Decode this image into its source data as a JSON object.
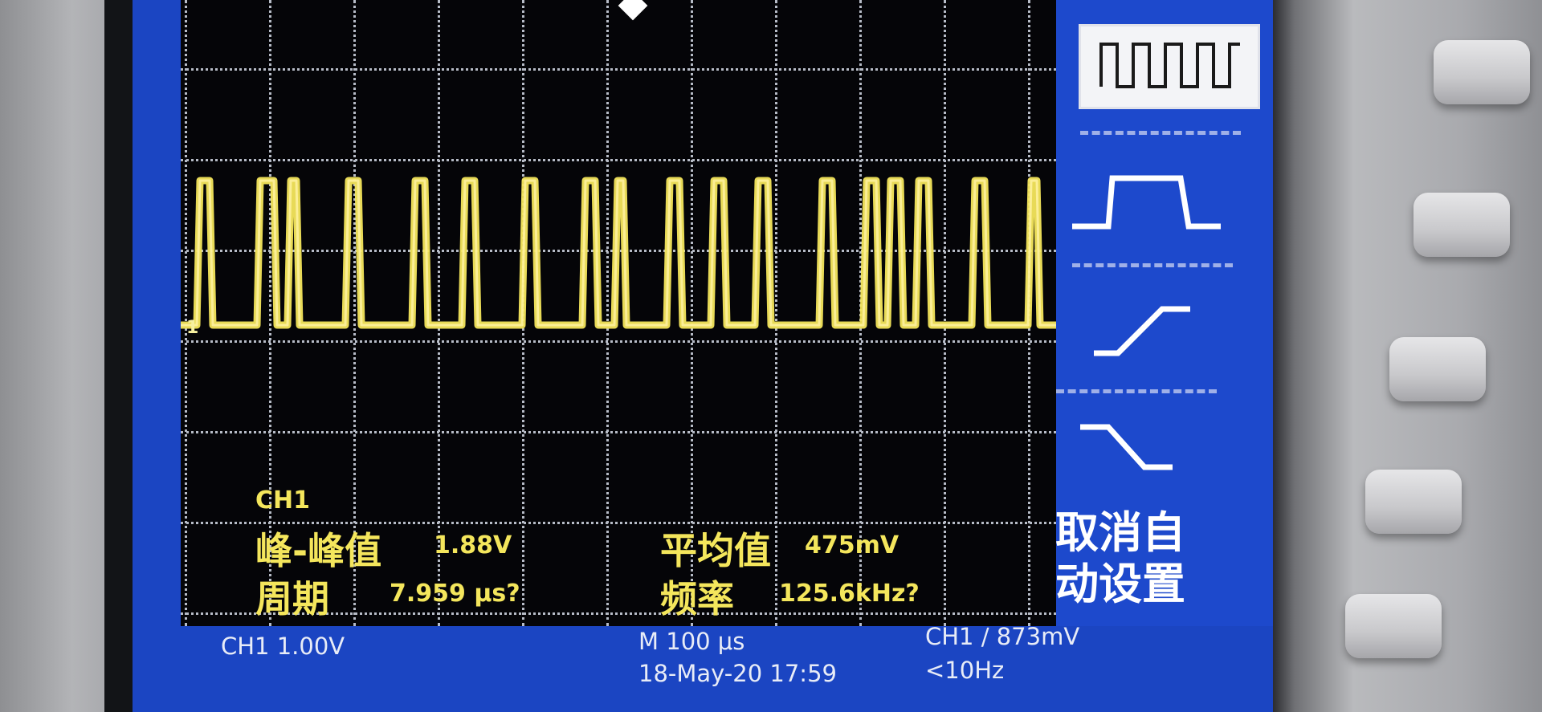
{
  "channel_marker": "1",
  "measurements": {
    "channel": "CH1",
    "peak_to_peak_label": "峰-峰值",
    "peak_to_peak_value": "1.88V",
    "period_label": "周期",
    "period_value": "7.959 μs?",
    "mean_label": "平均值",
    "mean_value": "475mV",
    "frequency_label": "频率",
    "frequency_value": "125.6kHz?"
  },
  "side_menu": {
    "items": [
      {
        "icon": "pulse-train-icon",
        "selected": true
      },
      {
        "icon": "pulse-icon",
        "selected": false
      },
      {
        "icon": "rising-edge-icon",
        "selected": false
      },
      {
        "icon": "falling-edge-icon",
        "selected": false
      }
    ],
    "cancel_label_line1": "取消自",
    "cancel_label_line2": "动设置"
  },
  "status_bar": {
    "channel_scale": "CH1  1.00V",
    "timebase": "M 100 μs",
    "datetime": "18-May-20 17:59",
    "trigger": "CH1 ∕ 873mV",
    "trigger_freq": "<10Hz"
  },
  "colors": {
    "trace": "#f4e65c",
    "screen_blue": "#1b45c2",
    "grid": "#b7bcc7"
  }
}
